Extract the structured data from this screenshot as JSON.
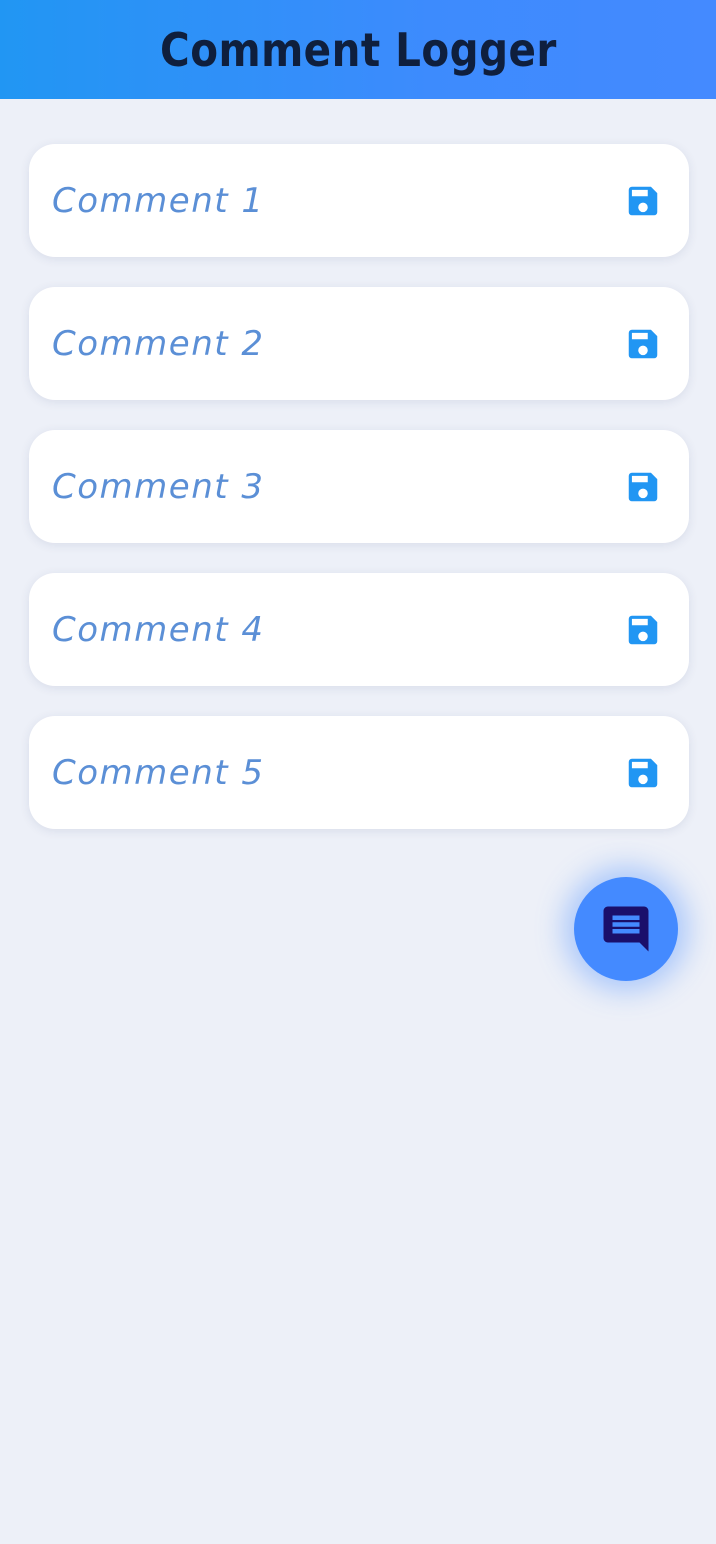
{
  "app_bar": {
    "title": "Comment Logger"
  },
  "comments": [
    {
      "text": "Comment 1",
      "action_icon": "save-icon"
    },
    {
      "text": "Comment 2",
      "action_icon": "save-icon"
    },
    {
      "text": "Comment 3",
      "action_icon": "save-icon"
    },
    {
      "text": "Comment 4",
      "action_icon": "save-icon"
    },
    {
      "text": "Comment 5",
      "action_icon": "save-icon"
    }
  ],
  "fab": {
    "icon": "comment-icon"
  },
  "colors": {
    "app_bar_start": "#2196f3",
    "app_bar_end": "#448aff",
    "title_text": "#0f1f3d",
    "background": "#edf0f8",
    "card_background": "#ffffff",
    "comment_text": "#5b8fd6",
    "save_icon": "#2196f3",
    "fab_background": "#448aff",
    "fab_icon": "#1a0f6b"
  }
}
